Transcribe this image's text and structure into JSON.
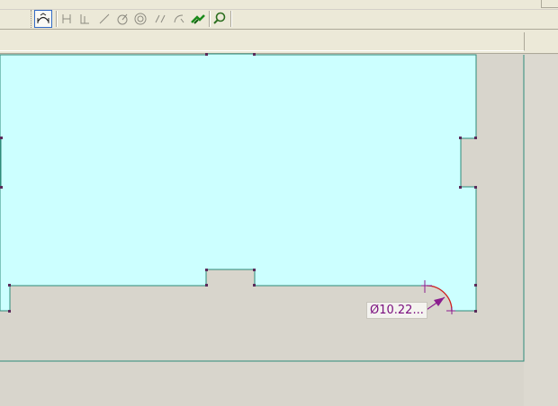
{
  "toolbar": {
    "buttons": [
      {
        "name": "smart-dimension-icon",
        "pressed": true
      },
      {
        "name": "horizontal-dimension-icon",
        "pressed": false
      },
      {
        "name": "vertical-dimension-icon",
        "pressed": false
      },
      {
        "name": "angular-dimension-icon",
        "pressed": false
      },
      {
        "name": "radial-dimension-icon",
        "pressed": false
      },
      {
        "name": "diameter-dimension-icon",
        "pressed": false
      },
      {
        "name": "parallel-constraint-icon",
        "pressed": false
      },
      {
        "name": "tangent-constraint-icon",
        "pressed": false
      },
      {
        "name": "repair-sketch-icon",
        "pressed": false
      },
      {
        "name": "zoom-icon",
        "pressed": false
      }
    ]
  },
  "drawing": {
    "dimension_text": "Ø10.22...",
    "colors": {
      "part_fill": "#ccffff",
      "part_edge": "#2e8b7a",
      "background": "#d8d5cc",
      "vertex": "#5a2a5a",
      "dimension": "#8b1d8e",
      "arc": "#d42020"
    }
  }
}
